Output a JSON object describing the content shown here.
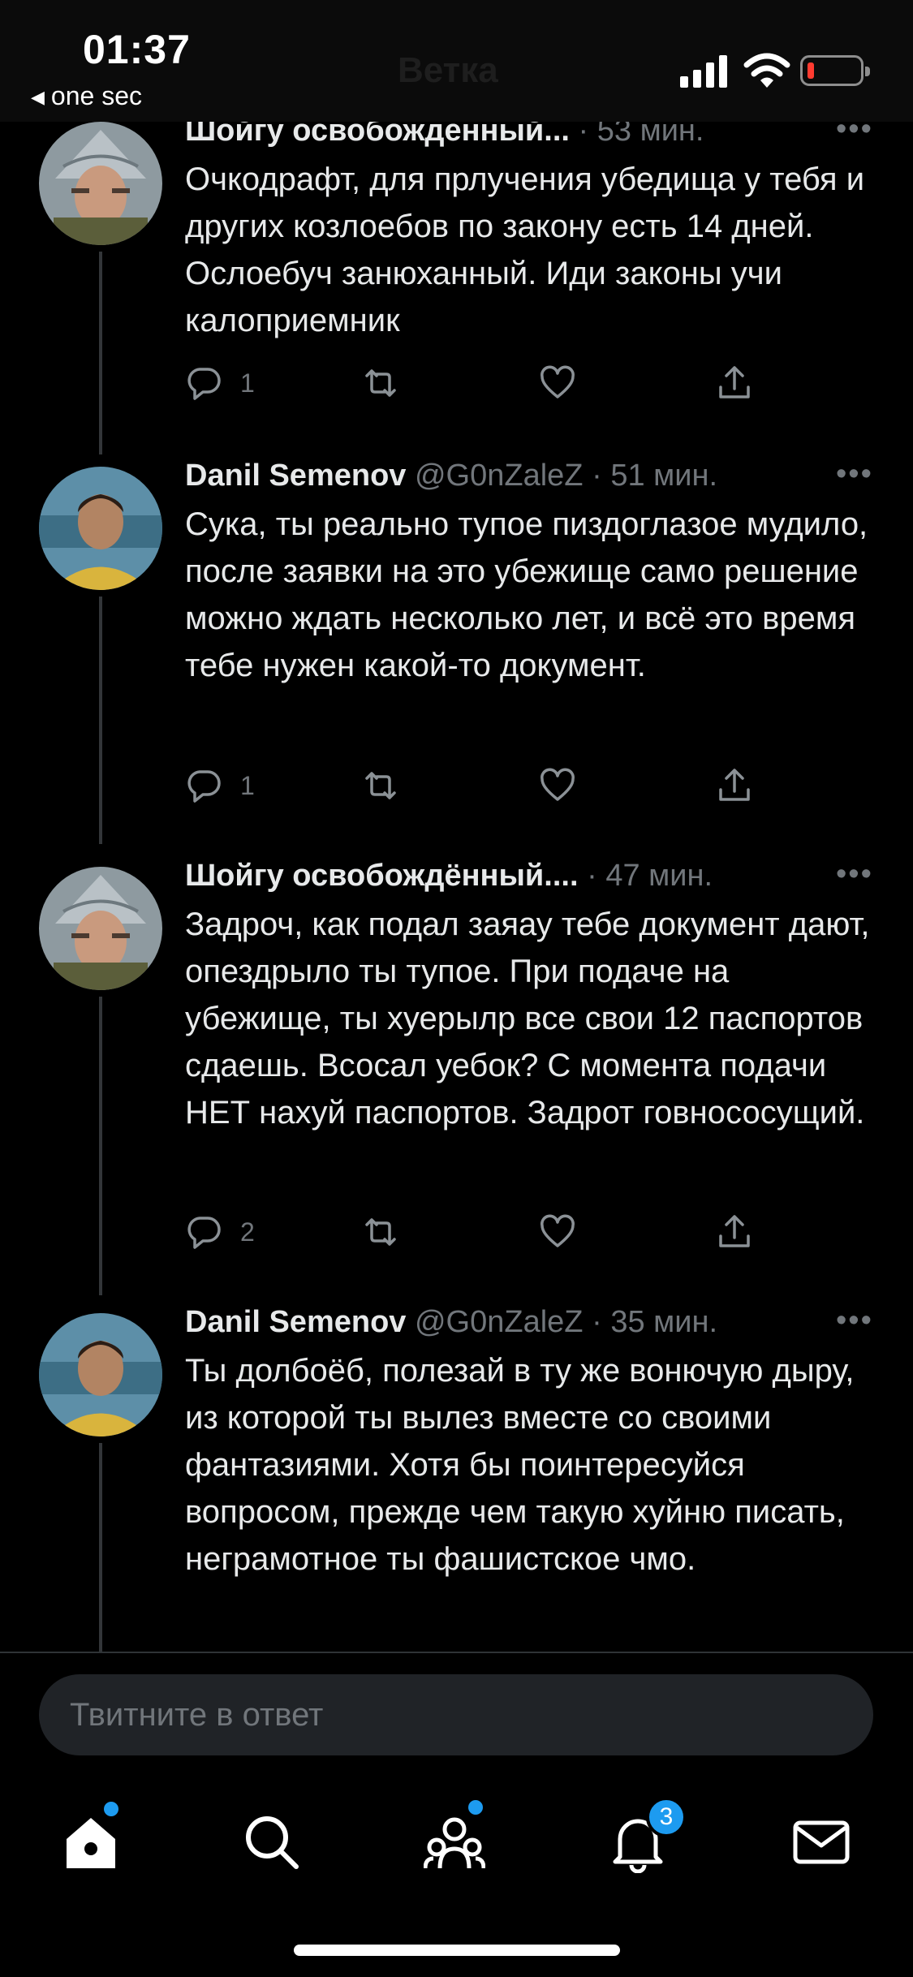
{
  "status_bar": {
    "time": "01:37",
    "back_app": "one sec",
    "battery_level": 0.08
  },
  "tweets": [
    {
      "name": "Шойгу освобожденный...",
      "handle": "",
      "time": "53 мин.",
      "text": "Очкодрафт, для прлучения убедища у тебя и других козлоебов по закону есть 14 дней. Ослоебуч занюханный. Иди законы учи калоприемник",
      "replies": "1"
    },
    {
      "name": "Danil Semenov",
      "handle": "@G0nZaleZ",
      "time": "51 мин.",
      "text": "Сука, ты реально тупое пиздоглазое мудило, после заявки на это убежище само решение можно ждать несколько лет, и всё это время тебе нужен какой-то документ.",
      "replies": "1"
    },
    {
      "name": "Шойгу освобождённый....",
      "handle": "",
      "time": "47 мин.",
      "text": "Задроч, как подал заяау тебе документ дают, опездрыло ты тупое. При подаче на убежище, ты хуерылр все свои 12 паспортов сдаешь. Всосал уебок? С момента подачи НЕТ нахуй паспортов. Задрот говнососущий.",
      "replies": "2"
    },
    {
      "name": "Danil Semenov",
      "handle": "@G0nZaleZ",
      "time": "35 мин.",
      "text": "Ты долбоёб, полезай в ту же вонючую дыру, из которой ты вылез вместе со своими фантазиями. Хотя бы поинтересуйся вопросом, прежде чем такую хуйню писать, неграмотное ты фашистское чмо.",
      "replies": ""
    }
  ],
  "reply": {
    "placeholder": "Твитните в ответ"
  },
  "tabbar": {
    "notifications_badge": "3"
  },
  "colors": {
    "background": "#000000",
    "accent": "#1d9bf0",
    "text": "#e7e9ea",
    "muted": "#71767b"
  }
}
